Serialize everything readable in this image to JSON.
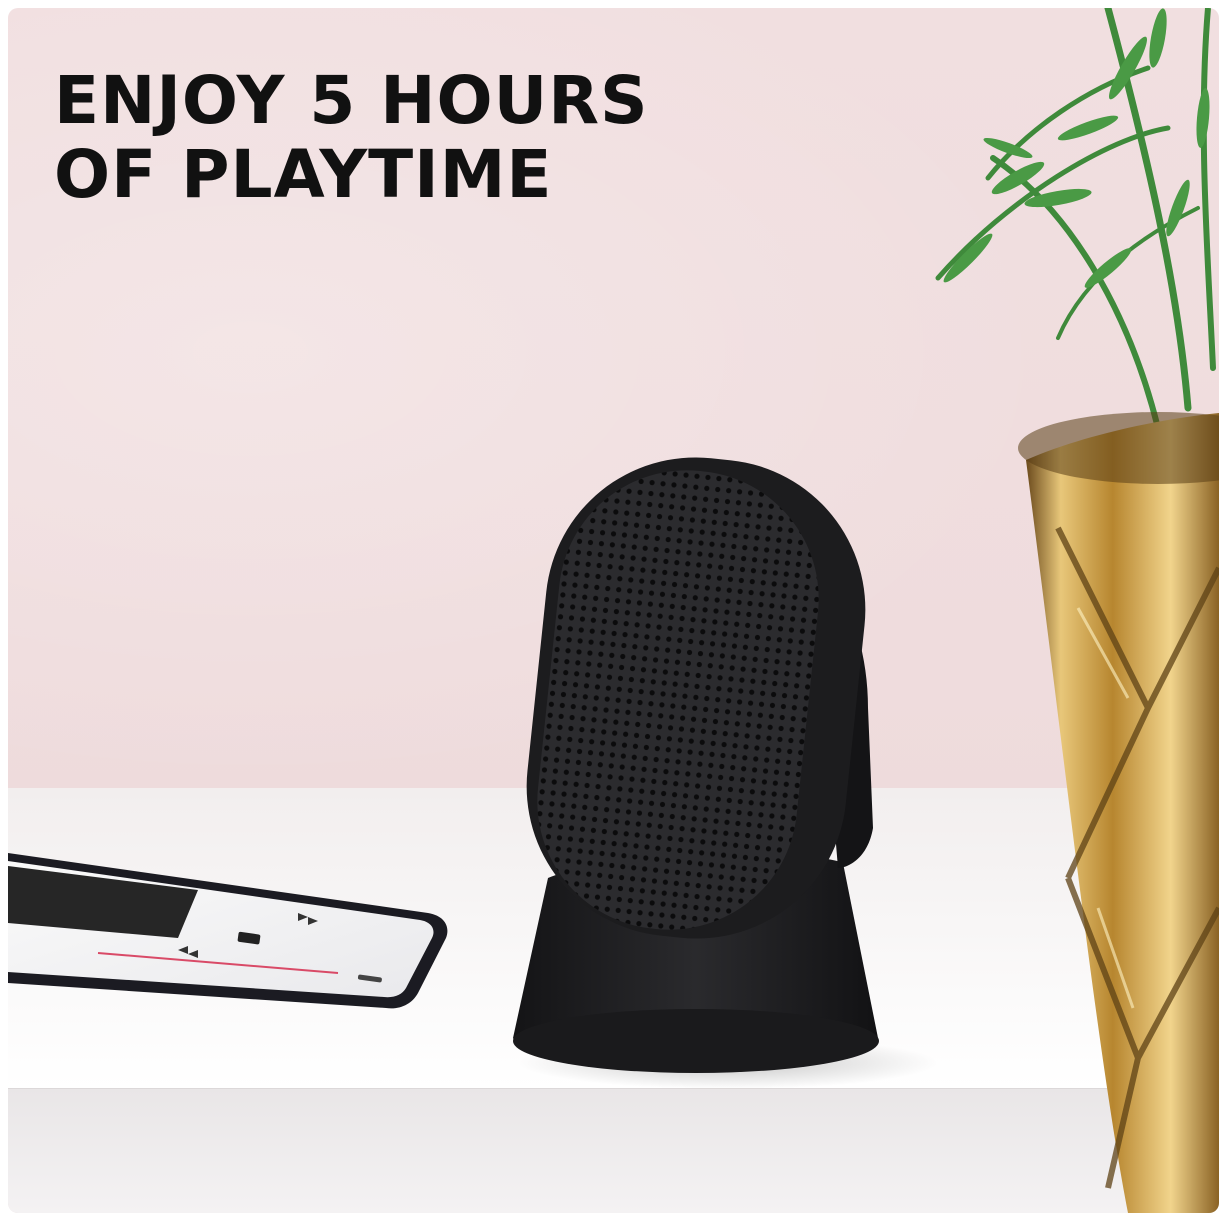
{
  "headline": {
    "line1": "ENJOY 5 HOURS",
    "line2": "OF PLAYTIME"
  },
  "colors": {
    "wall": "#efdcdd",
    "headline_text": "#111111",
    "speaker_body": "#1f1f21",
    "pot_gold": "#c9983e",
    "plant_leaf": "#3f8a3b"
  },
  "icons": {
    "speaker": "portable-speaker-image",
    "phone": "smartphone-image",
    "plant": "potted-plant-image"
  }
}
